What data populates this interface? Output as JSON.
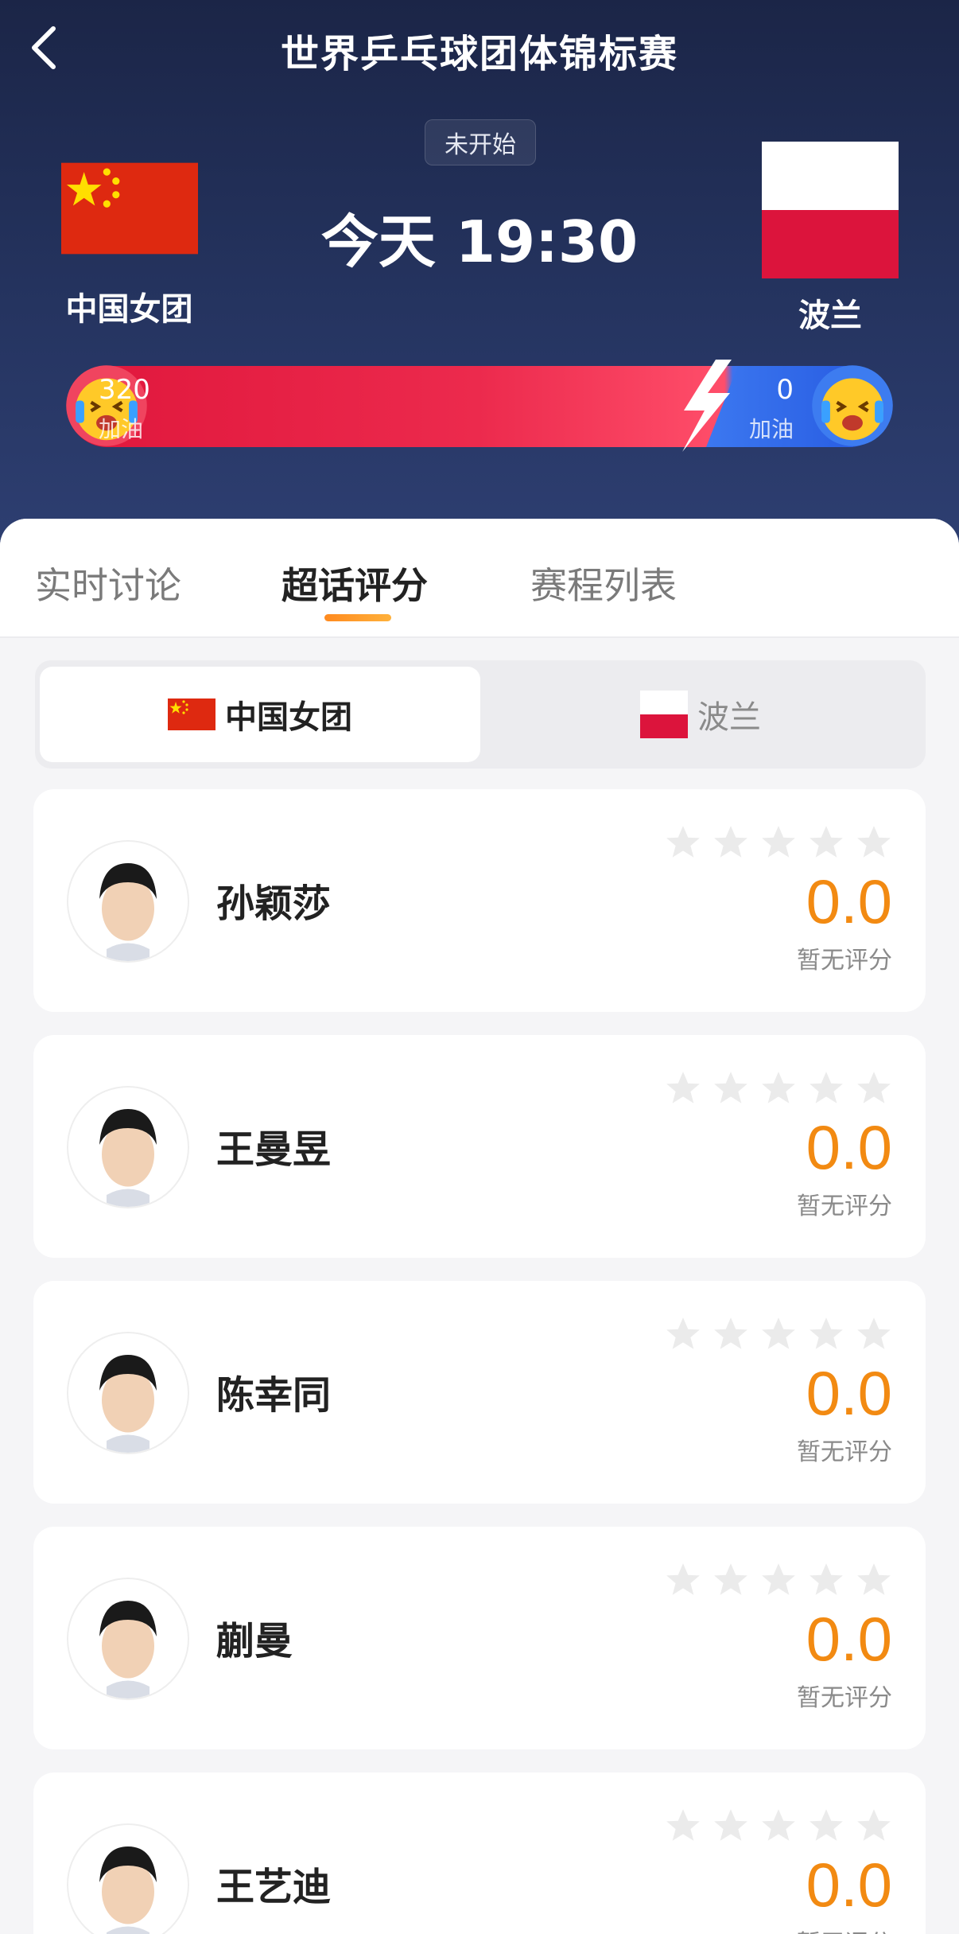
{
  "header": {
    "title": "世界乒乓球团体锦标赛",
    "status": "未开始",
    "match_time": "今天 19:30",
    "home_team": "中国女团",
    "away_team": "波兰",
    "home_flag": "china-flag",
    "away_flag": "poland-flag"
  },
  "cheer": {
    "home_count": "320",
    "home_label": "加油",
    "away_count": "0",
    "away_label": "加油",
    "home_color": "#e0173c",
    "away_color": "#2b62e8"
  },
  "tabs": [
    {
      "label": "实时讨论"
    },
    {
      "label": "超话评分"
    },
    {
      "label": "赛程列表"
    }
  ],
  "active_tab": "超话评分",
  "team_switch": {
    "home_label": "中国女团",
    "away_label": "波兰"
  },
  "players": [
    {
      "name": "孙颖莎",
      "score": "0.0",
      "note": "暂无评分"
    },
    {
      "name": "王曼昱",
      "score": "0.0",
      "note": "暂无评分"
    },
    {
      "name": "陈幸同",
      "score": "0.0",
      "note": "暂无评分"
    },
    {
      "name": "蒯曼",
      "score": "0.0",
      "note": "暂无评分"
    },
    {
      "name": "王艺迪",
      "score": "0.0",
      "note": "暂无评分"
    }
  ],
  "colors": {
    "accent": "#f28a12",
    "header_bg": "#1b2547"
  }
}
